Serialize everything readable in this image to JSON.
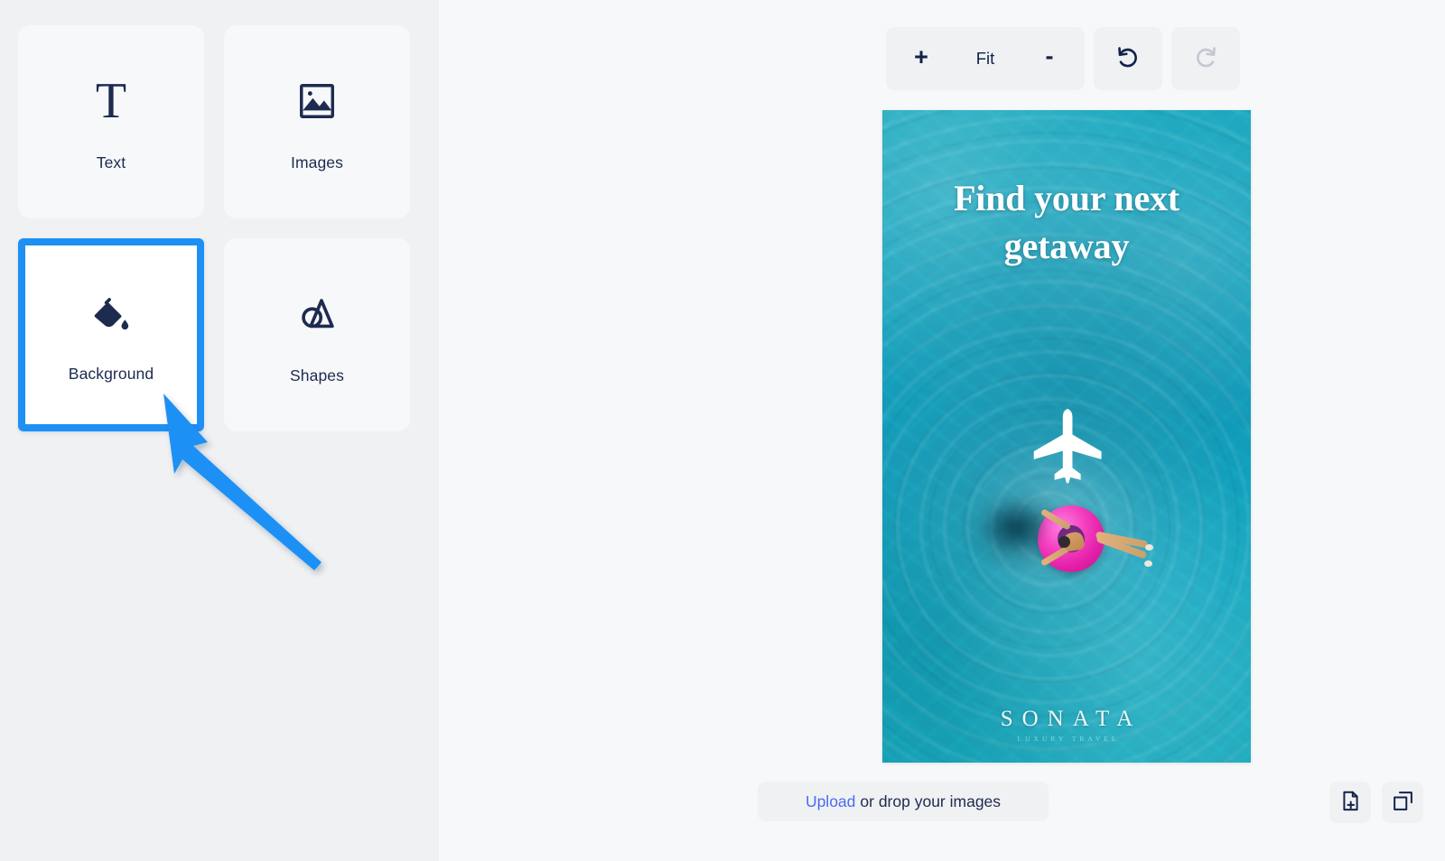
{
  "sidebar": {
    "tiles": [
      {
        "id": "text",
        "label": "Text",
        "icon": "text-t-icon",
        "selected": false
      },
      {
        "id": "images",
        "label": "Images",
        "icon": "image-icon",
        "selected": false
      },
      {
        "id": "background",
        "label": "Background",
        "icon": "paint-bucket-icon",
        "selected": true
      },
      {
        "id": "shapes",
        "label": "Shapes",
        "icon": "shapes-icon",
        "selected": false
      }
    ],
    "selection_color": "#1e90f5",
    "background_color": "#f0f1f3",
    "tile_color": "#f7f8fa",
    "label_color": "#1d2b4f"
  },
  "annotation": {
    "type": "pointer-arrow",
    "color": "#1e90f5",
    "points_to": "background"
  },
  "toolbar": {
    "zoom_in_label": "+",
    "zoom_fit_label": "Fit",
    "zoom_out_label": "-",
    "undo_icon": "undo-arrow-icon",
    "redo_icon": "redo-arrow-icon",
    "undo_enabled": true,
    "redo_enabled": false,
    "icon_color": "#12224b",
    "disabled_color": "#c2c7d2"
  },
  "poster": {
    "headline": "Find your next getaway",
    "graphic_icon": "airplane-icon",
    "brand_name": "SONATA",
    "brand_subtitle": "LUXURY TRAVEL",
    "background_theme": "turquoise-pool-water",
    "water_color": "#17a3bb",
    "float_ring_color": "#e21fa8",
    "headline_color": "#ffffff"
  },
  "footer": {
    "upload_link_label": "Upload",
    "upload_rest_label": "or drop your images",
    "upload_link_color": "#4a6cf0",
    "add_page_icon": "add-page-icon",
    "duplicate_page_icon": "duplicate-page-icon"
  }
}
